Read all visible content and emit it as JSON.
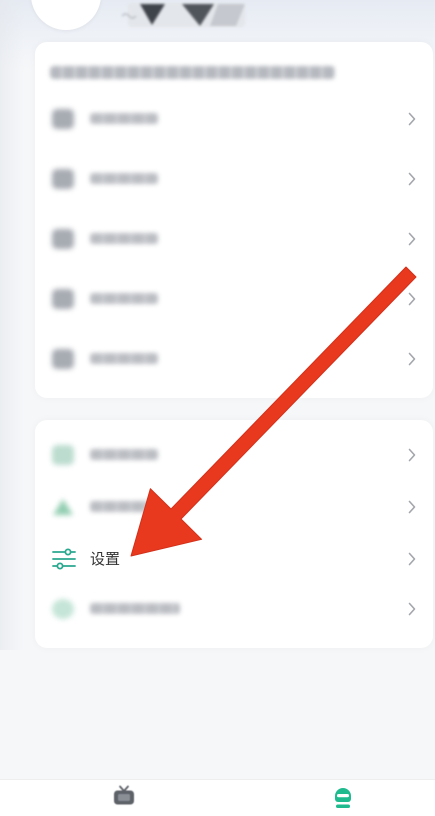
{
  "colors": {
    "page_background": "#f6f7f9",
    "card_background": "#ffffff",
    "accent_green": "#1fba8e",
    "settings_icon": "#2aa88f",
    "arrow_red": "#e8391e",
    "chevron_gray": "#a3a6ab",
    "label_text": "#333333",
    "nav_inactive": "#5d6168"
  },
  "header": {
    "avatar": "avatar-icon",
    "logo": "logo-icon"
  },
  "menu_card_primary": {
    "items": [
      {
        "icon": "blurred-icon",
        "trailing": "chevron-right-icon"
      },
      {
        "icon": "blurred-icon",
        "trailing": "chevron-right-icon"
      },
      {
        "icon": "blurred-icon",
        "trailing": "chevron-right-icon"
      },
      {
        "icon": "blurred-icon",
        "trailing": "chevron-right-icon"
      },
      {
        "icon": "blurred-icon",
        "trailing": "chevron-right-icon"
      }
    ]
  },
  "menu_card_secondary": {
    "items": [
      {
        "icon": "blurred-icon",
        "trailing": "chevron-right-icon"
      },
      {
        "icon": "blurred-icon",
        "trailing": "chevron-right-icon"
      },
      {
        "icon": "sliders-icon",
        "label": "设置",
        "trailing": "chevron-right-icon"
      },
      {
        "icon": "blurred-icon",
        "trailing": "chevron-right-icon"
      }
    ]
  },
  "annotation": {
    "icon": "red-arrow-icon"
  },
  "bottom_nav": {
    "tabs": [
      {
        "icon": "tv-icon",
        "active": false
      },
      {
        "icon": "mascot-icon",
        "active": true
      }
    ]
  }
}
